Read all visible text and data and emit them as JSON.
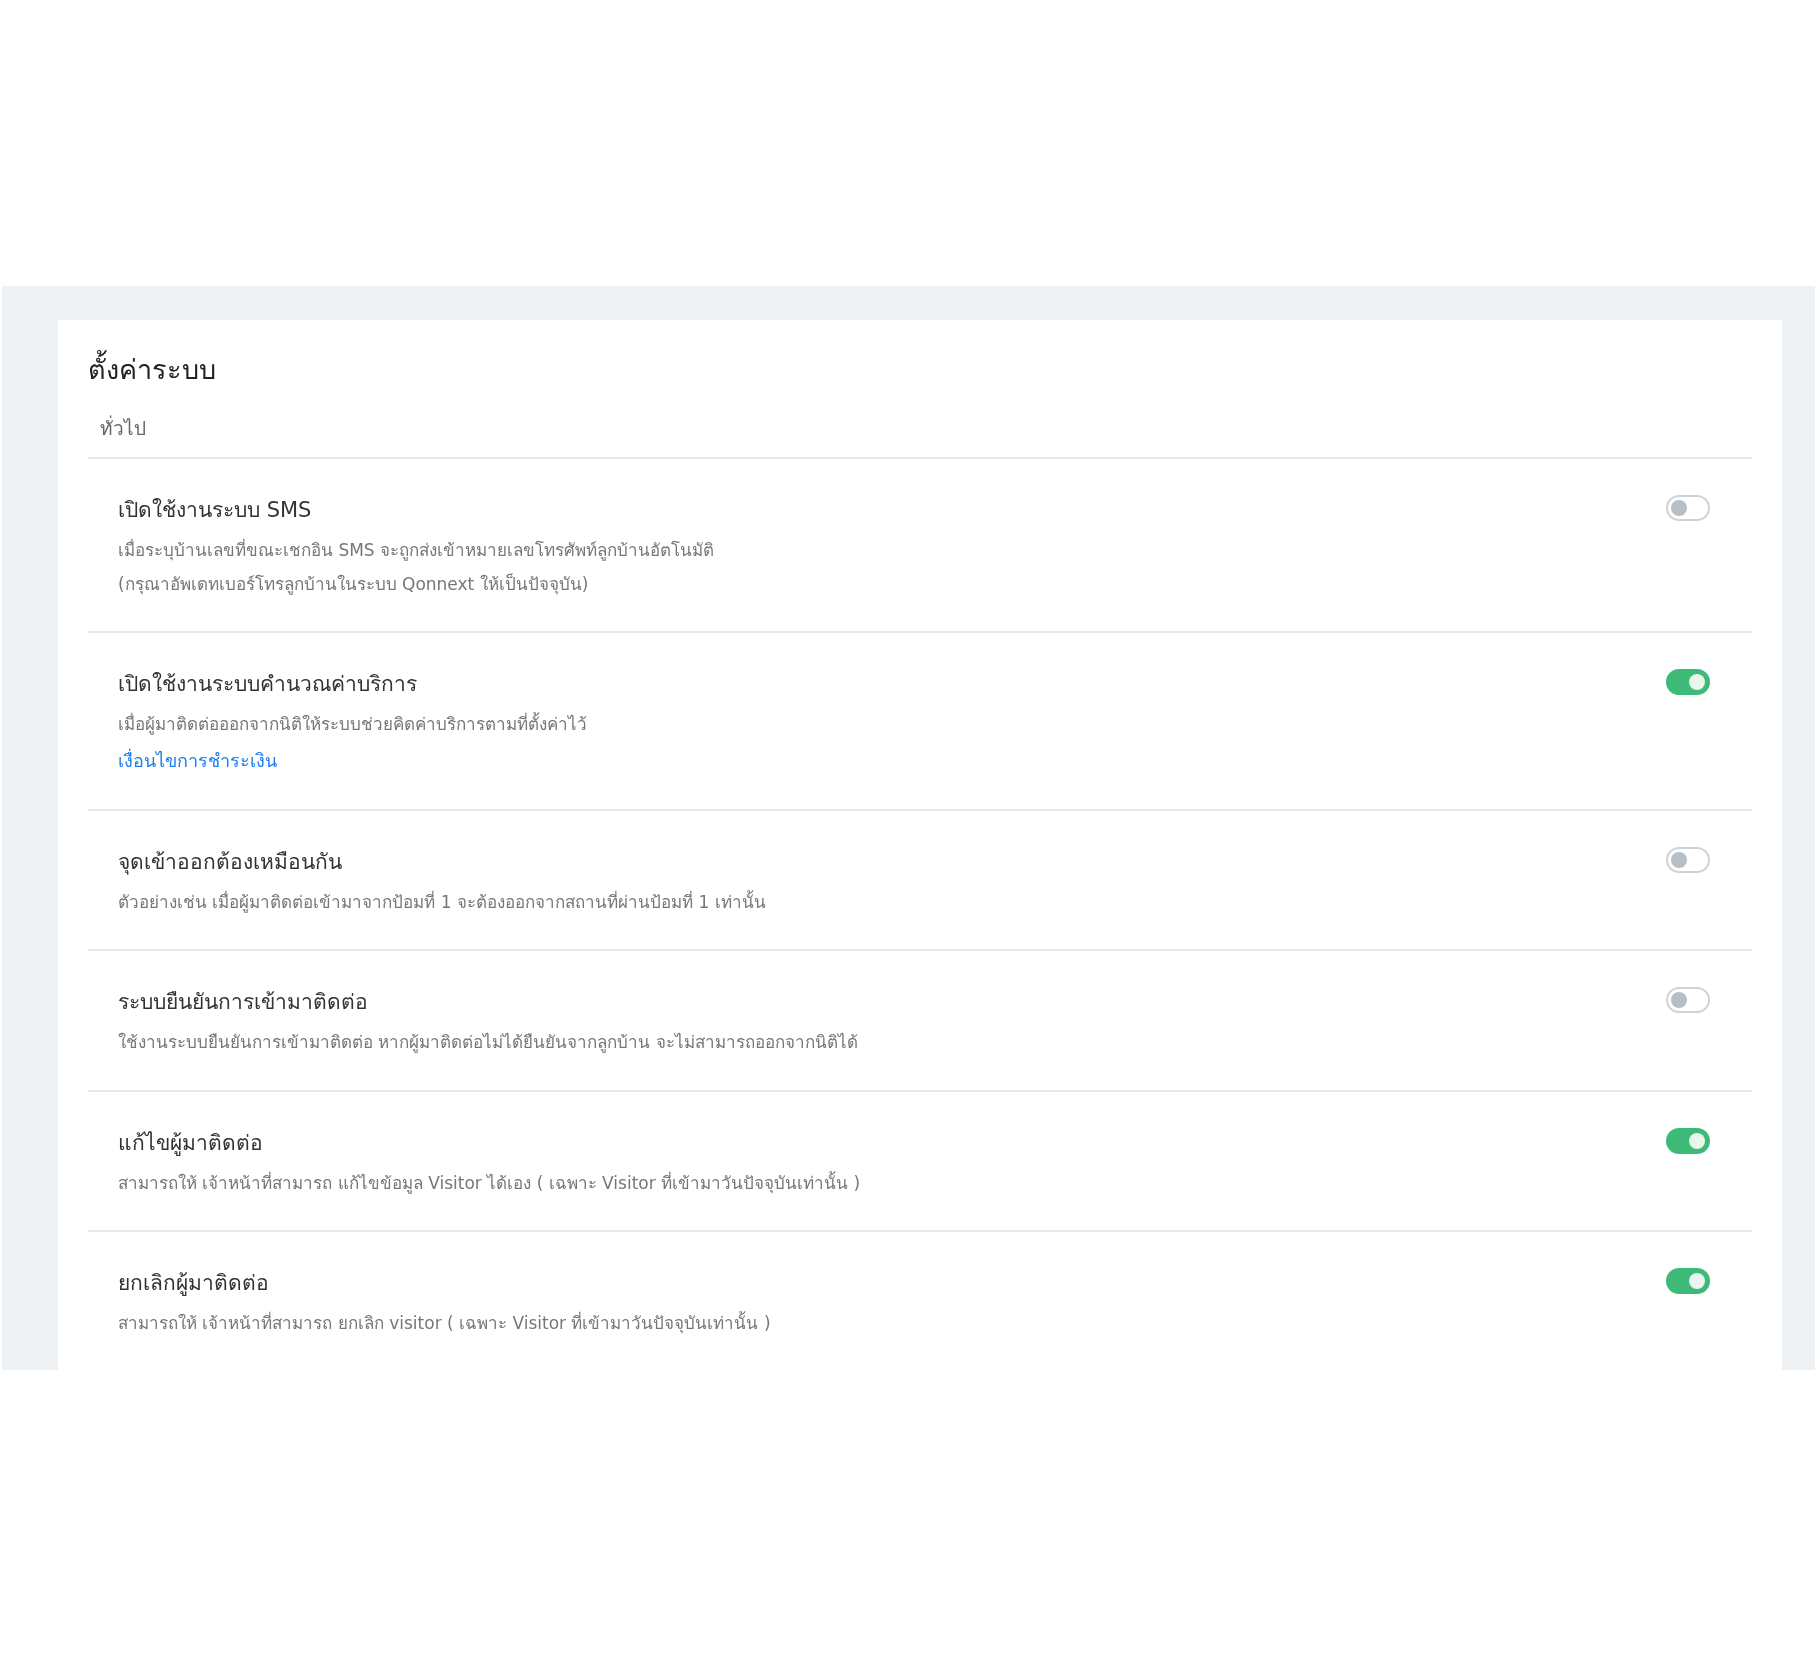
{
  "title": "ตั้งค่าระบบ",
  "section": "ทั่วไป",
  "settings": [
    {
      "title": "เปิดใช้งานระบบ SMS",
      "description": [
        "เมื่อระบุบ้านเลขที่ขณะเชกอิน SMS จะถูกส่งเข้าหมายเลขโทรศัพท์ลูกบ้านอัตโนมัติ",
        "(กรุณาอัพเดทเบอร์โทรลูกบ้านในระบบ Qonnext ให้เป็นปัจจุบัน)"
      ],
      "on": false
    },
    {
      "title": "เปิดใช้งานระบบคำนวณค่าบริการ",
      "description": [
        "เมื่อผู้มาติดต่อออกจากนิติให้ระบบช่วยคิดค่าบริการตามที่ตั้งค่าไว้"
      ],
      "link": "เงื่อนไขการชำระเงิน",
      "on": true
    },
    {
      "title": "จุดเข้าออกต้องเหมือนกัน",
      "description": [
        "ตัวอย่างเช่น เมื่อผู้มาติดต่อเข้ามาจากป้อมที่ 1 จะต้องออกจากสถานที่ผ่านป้อมที่ 1 เท่านั้น"
      ],
      "on": false
    },
    {
      "title": "ระบบยืนยันการเข้ามาติดต่อ",
      "description": [
        "ใช้งานระบบยืนยันการเข้ามาติดต่อ หากผู้มาติดต่อไม่ได้ยืนยันจากลูกบ้าน จะไม่สามารถออกจากนิติได้"
      ],
      "on": false
    },
    {
      "title": "แก้ไขผู้มาติดต่อ",
      "description": [
        "สามารถให้ เจ้าหน้าที่สามารถ แก้ไขข้อมูล Visitor ได้เอง ( เฉพาะ Visitor ที่เข้ามาวันปัจจุบันเท่านั้น )"
      ],
      "on": true
    },
    {
      "title": "ยกเลิกผู้มาติดต่อ",
      "description": [
        "สามารถให้ เจ้าหน้าที่สามารถ ยกเลิก visitor ( เฉพาะ Visitor ที่เข้ามาวันปัจจุบันเท่านั้น )"
      ],
      "on": true
    }
  ]
}
